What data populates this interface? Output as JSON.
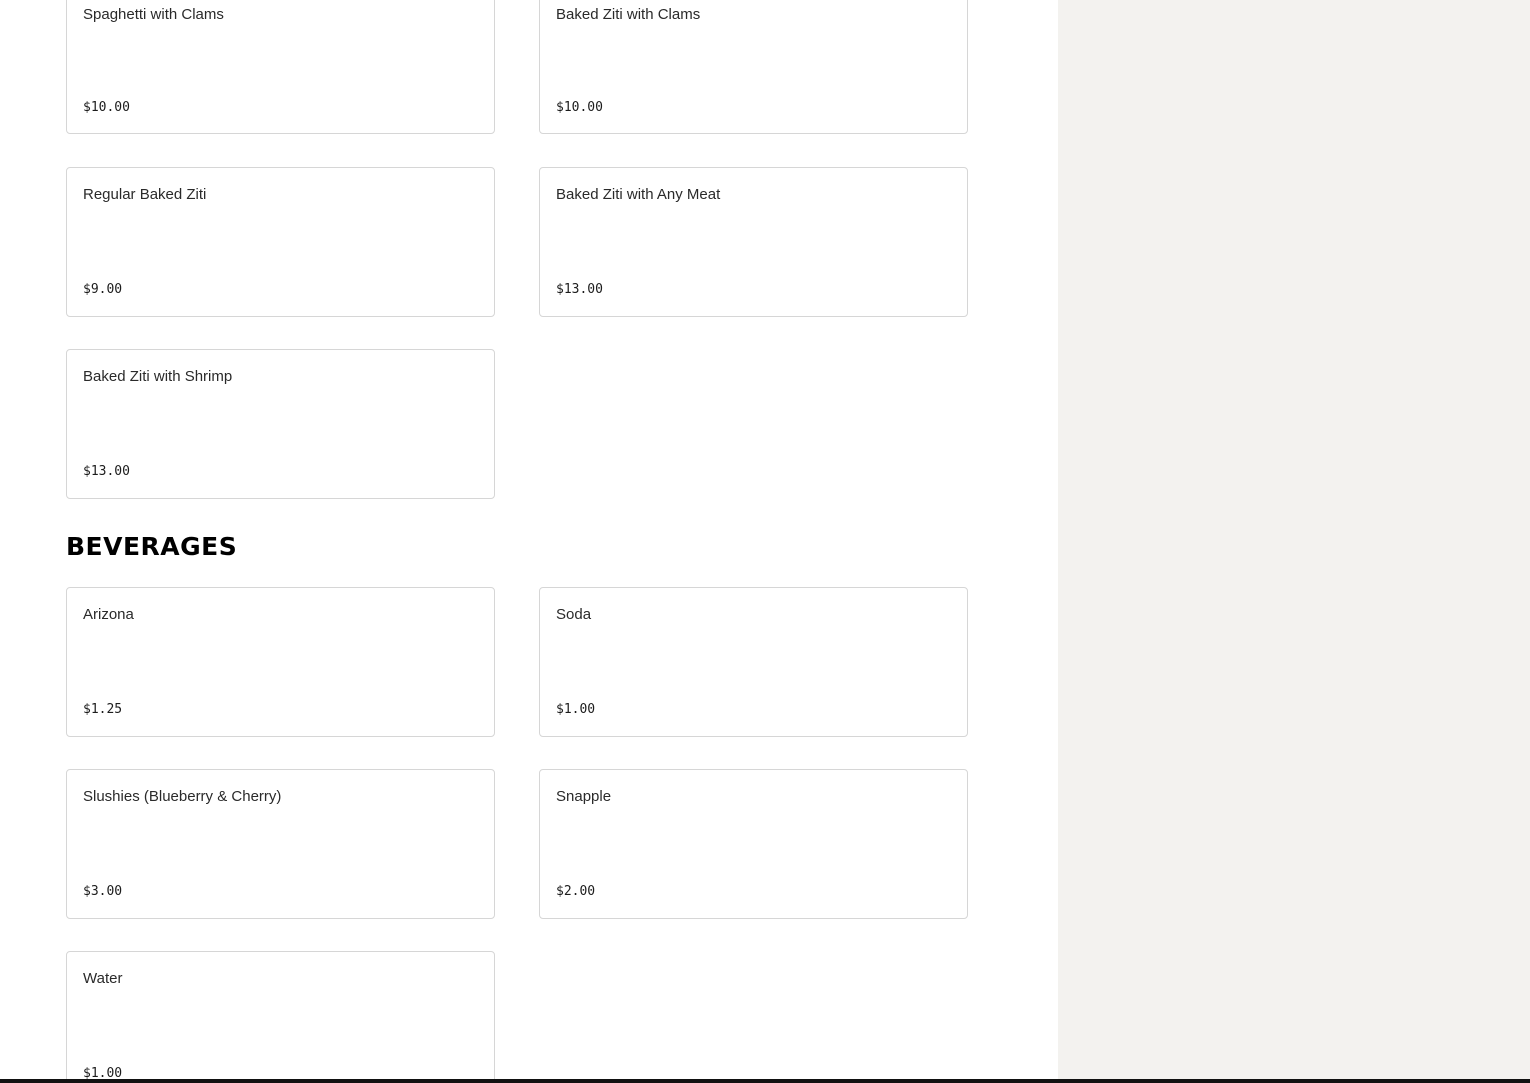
{
  "pasta_items": [
    {
      "name": "Spaghetti with Clams",
      "price": "$10.00"
    },
    {
      "name": "Baked Ziti with Clams",
      "price": "$10.00"
    },
    {
      "name": "Regular Baked Ziti",
      "price": "$9.00"
    },
    {
      "name": "Baked Ziti with Any Meat",
      "price": "$13.00"
    },
    {
      "name": "Baked Ziti with Shrimp",
      "price": "$13.00"
    }
  ],
  "beverages": {
    "heading": "BEVERAGES",
    "items": [
      {
        "name": "Arizona",
        "price": "$1.25"
      },
      {
        "name": "Soda",
        "price": "$1.00"
      },
      {
        "name": "Slushies (Blueberry & Cherry)",
        "price": "$3.00"
      },
      {
        "name": "Snapple",
        "price": "$2.00"
      },
      {
        "name": "Water",
        "price": "$1.00"
      }
    ]
  },
  "colors": {
    "sidebar_background": "#f3f2ef",
    "card_border": "#d6d6d6",
    "bottom_bar": "#111111"
  }
}
